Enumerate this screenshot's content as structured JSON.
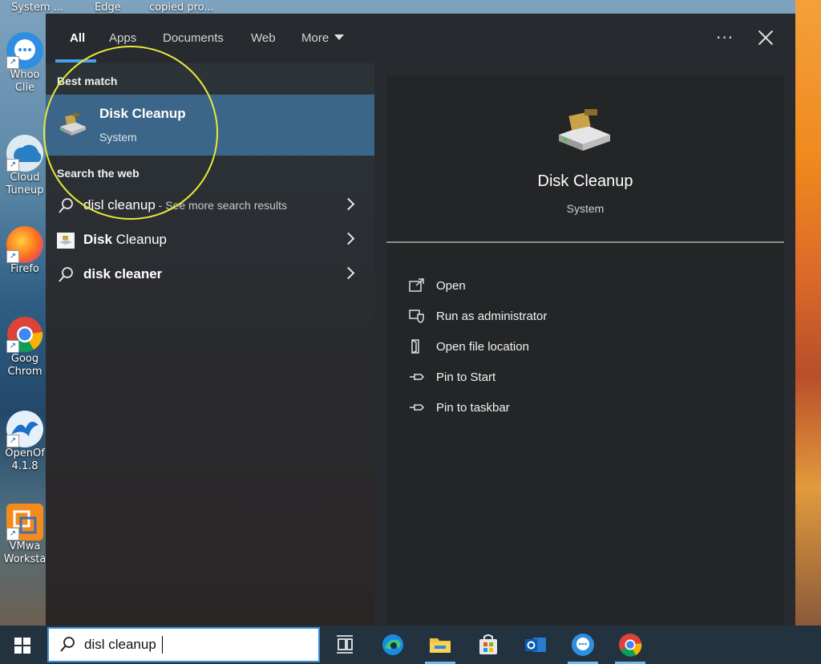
{
  "desktop": {
    "top_labels": [
      "System ...",
      "Edge",
      "copied pro..."
    ],
    "icons": [
      {
        "label": "Whoo\nClie",
        "icon": "chat-bubble-icon"
      },
      {
        "label": "Cloud\nTuneup",
        "icon": "cloud-tuneup-icon"
      },
      {
        "label": "Firefo",
        "icon": "firefox-icon"
      },
      {
        "label": "Goog\nChrom",
        "icon": "chrome-icon"
      },
      {
        "label": "OpenOf\n4.1.8",
        "icon": "openoffice-icon"
      },
      {
        "label": "VMwa\nWorksta",
        "icon": "vmware-icon"
      }
    ]
  },
  "search_panel": {
    "tabs": [
      {
        "label": "All",
        "active": true
      },
      {
        "label": "Apps",
        "active": false
      },
      {
        "label": "Documents",
        "active": false
      },
      {
        "label": "Web",
        "active": false
      },
      {
        "label": "More",
        "active": false
      }
    ],
    "more_button_icon": "ellipsis-icon",
    "close_button_icon": "close-icon",
    "best_match_heading": "Best match",
    "best_match": {
      "title": "Disk Cleanup",
      "subtitle": "System",
      "icon": "disk-cleanup-icon"
    },
    "web_heading": "Search the web",
    "web_results": [
      {
        "main": "disl cleanup",
        "sub": " - See more search results",
        "icon": "search-icon"
      },
      {
        "main": "Disk Cleanup",
        "sub": "",
        "icon": "disk-cleanup-small-icon"
      },
      {
        "main": "disk cleaner",
        "sub": "",
        "icon": "search-icon"
      }
    ],
    "detail": {
      "title": "Disk Cleanup",
      "subtitle": "System",
      "actions": [
        {
          "label": "Open",
          "icon": "open-icon"
        },
        {
          "label": "Run as administrator",
          "icon": "shield-icon"
        },
        {
          "label": "Open file location",
          "icon": "file-location-icon"
        },
        {
          "label": "Pin to Start",
          "icon": "pin-icon"
        },
        {
          "label": "Pin to taskbar",
          "icon": "pin-icon"
        }
      ]
    }
  },
  "taskbar": {
    "search_value": "disl cleanup",
    "apps": [
      "task-view-icon",
      "edge-icon",
      "file-explorer-icon",
      "store-icon",
      "outlook-icon",
      "chat-icon",
      "chrome-icon"
    ]
  },
  "colors": {
    "accent_blue": "#4aa0f0",
    "selection": "#3c6689",
    "highlight_circle": "#e8e83a",
    "taskbar": "#22323f"
  }
}
